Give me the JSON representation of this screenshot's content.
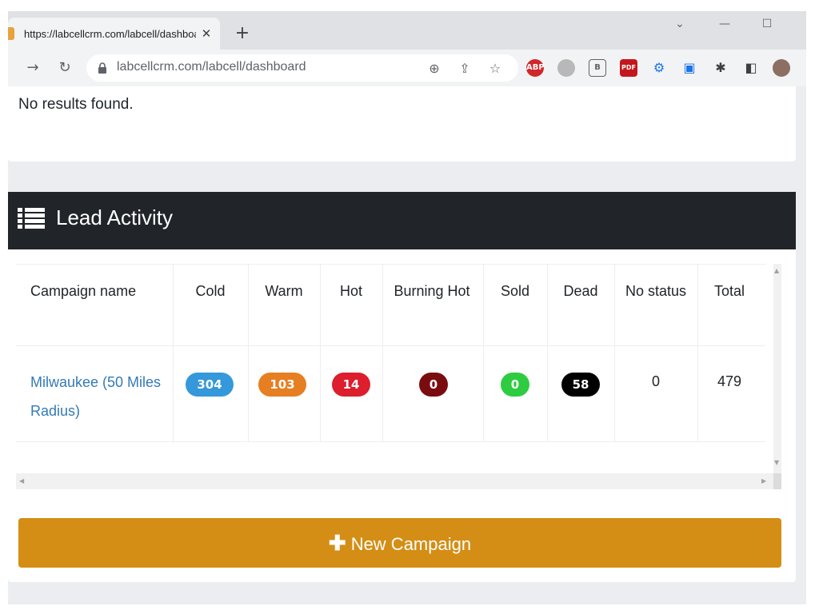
{
  "browser": {
    "tab_title": "https://labcellcrm.com/labcell/dashboard",
    "tab_close": "✕",
    "new_tab": "+",
    "url": "labcellcrm.com/labcell/dashboard",
    "extensions": [
      "ABP",
      "B",
      "PDF"
    ]
  },
  "page": {
    "no_results": "No results found.",
    "lead_activity": {
      "title": "Lead Activity",
      "columns": [
        "Campaign name",
        "Cold",
        "Warm",
        "Hot",
        "Burning Hot",
        "Sold",
        "Dead",
        "No status",
        "Total"
      ],
      "rows": [
        {
          "campaign": "Milwaukee (50 Miles Radius)",
          "cold": "304",
          "warm": "103",
          "hot": "14",
          "burning_hot": "0",
          "sold": "0",
          "dead": "58",
          "no_status": "0",
          "total": "479"
        }
      ]
    },
    "new_campaign_button": "New Campaign",
    "plus": "✚"
  },
  "colors": {
    "cold": "#3498db",
    "warm": "#e67e22",
    "hot": "#dc1e2d",
    "burning_hot": "#7a0c10",
    "sold": "#2ecc40",
    "dead": "#000000",
    "header": "#212529",
    "button": "#d48e15",
    "link": "#337ab7"
  }
}
